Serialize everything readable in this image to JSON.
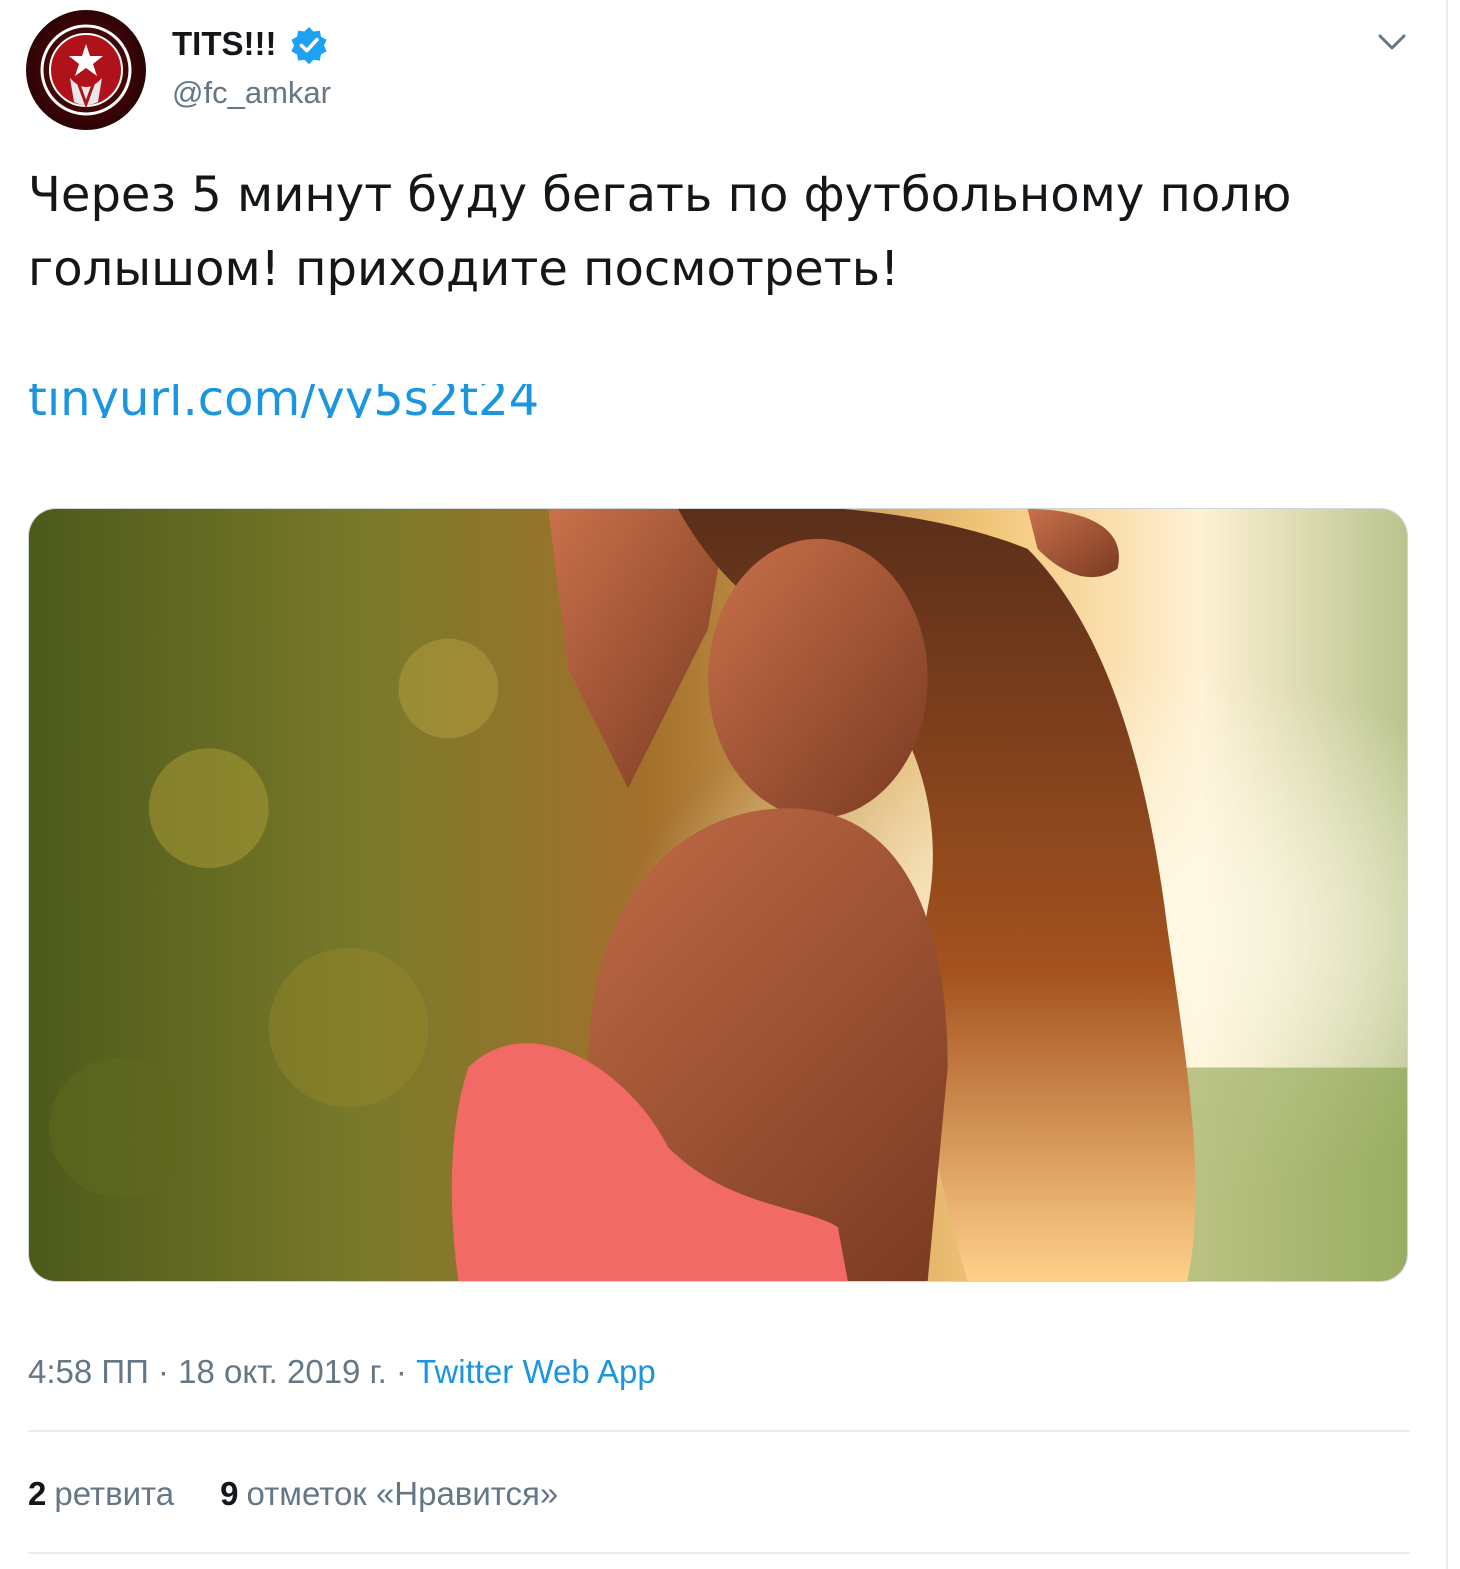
{
  "tweet": {
    "display_name": "TITS!!!",
    "verified_icon": "verified-badge-icon",
    "handle": "@fc_amkar",
    "menu_icon": "chevron-down-icon",
    "text": "Через 5 минут буду бегать по футбольному полю голышом! приходите посмотреть!",
    "link": "tinyurl.com/yy5s2t24",
    "media": "photo",
    "time": "4:58 ПП",
    "separator": " · ",
    "date": "18 окт. 2019 г.",
    "source": "Twitter Web App",
    "retweets_count": "2",
    "retweets_label": "ретвита",
    "likes_count": "9",
    "likes_label": "отметок «Нравится»"
  },
  "colors": {
    "link": "#1b95e0",
    "secondary_text": "#657786",
    "primary_text": "#14171a",
    "divider": "#e6ecf0",
    "verified": "#1da1f2"
  }
}
